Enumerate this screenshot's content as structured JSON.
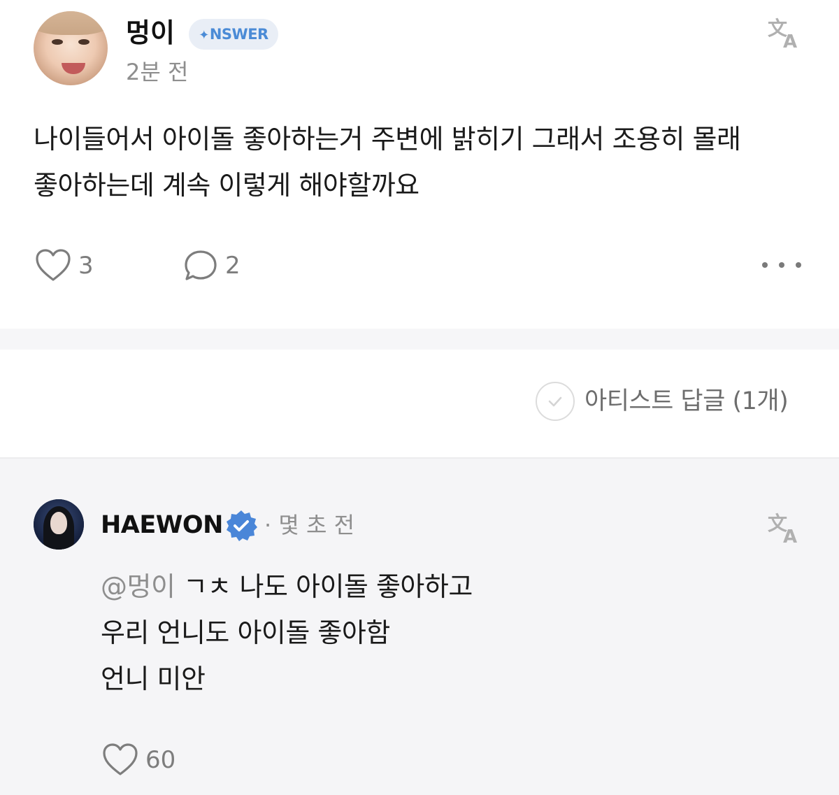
{
  "post": {
    "username": "멍이",
    "badge_label": "NSWER",
    "time": "2분 전",
    "body_lines": [
      "나이들어서 아이돌 좋아하는거 주변에 밝히기 그래서 조용히 몰래",
      "좋아하는데 계속 이렇게 해야할까요"
    ],
    "likes": "3",
    "comments": "2"
  },
  "replies_header": {
    "filter_label": "아티스트 답글 (1개)"
  },
  "reply": {
    "username": "HAEWON",
    "time": "· 몇 초 전",
    "mention": "@멍이",
    "body_lines": [
      " ㄱㅊ 나도 아이돌 좋아하고",
      "우리 언니도 아이돌 좋아함",
      "언니 미안"
    ],
    "likes": "60"
  },
  "colors": {
    "badge_text": "#4b8bd6",
    "badge_bg": "#e9eef6",
    "verified": "#4a86d8",
    "reply_bg": "#f5f5f7"
  },
  "icons": [
    "translate-icon",
    "heart-icon",
    "comment-icon",
    "more-icon",
    "check-circle-icon",
    "verified-icon"
  ]
}
